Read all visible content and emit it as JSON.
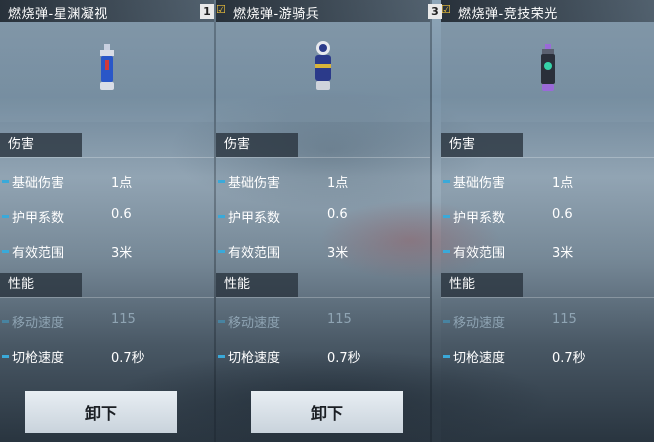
{
  "panels": [
    {
      "title": "燃烧弹-星渊凝视",
      "slot": "1",
      "show_check": false,
      "grenade_colors": {
        "cap": "#c8d0e0",
        "body": "#2a57c8",
        "accent": "#d13a3a",
        "base": "#d9dde6"
      },
      "section_damage": "伤害",
      "stats_damage": [
        {
          "label": "基础伤害",
          "value": "1点"
        },
        {
          "label": "护甲系数",
          "value": "0.6"
        },
        {
          "label": "有效范围",
          "value": "3米"
        }
      ],
      "section_performance": "性能",
      "stats_performance": [
        {
          "label": "移动速度",
          "value": "115"
        },
        {
          "label": "切枪速度",
          "value": "0.7秒"
        }
      ],
      "button": "卸下"
    },
    {
      "title": "燃烧弹-游骑兵",
      "slot": "",
      "show_check": true,
      "grenade_colors": {
        "cap": "#e7e9ee",
        "body": "#2b3a8a",
        "accent": "#d9b43a",
        "base": "#cfd3db"
      },
      "section_damage": "伤害",
      "stats_damage": [
        {
          "label": "基础伤害",
          "value": "1点"
        },
        {
          "label": "护甲系数",
          "value": "0.6"
        },
        {
          "label": "有效范围",
          "value": "3米"
        }
      ],
      "section_performance": "性能",
      "stats_performance": [
        {
          "label": "移动速度",
          "value": "115"
        },
        {
          "label": "切枪速度",
          "value": "0.7秒"
        }
      ],
      "button": "卸下"
    },
    {
      "title": "燃烧弹-竞技荣光",
      "slot": "3",
      "show_check": true,
      "grenade_colors": {
        "cap": "#9a6ad8",
        "body": "#2a2f3a",
        "accent": "#35d1a8",
        "base": "#5a6070"
      },
      "section_damage": "伤害",
      "stats_damage": [
        {
          "label": "基础伤害",
          "value": "1点"
        },
        {
          "label": "护甲系数",
          "value": "0.6"
        },
        {
          "label": "有效范围",
          "value": "3米"
        }
      ],
      "section_performance": "性能",
      "stats_performance": [
        {
          "label": "移动速度",
          "value": "115"
        },
        {
          "label": "切枪速度",
          "value": "0.7秒"
        }
      ]
    }
  ],
  "icons": {
    "check": "checkmark-icon"
  }
}
